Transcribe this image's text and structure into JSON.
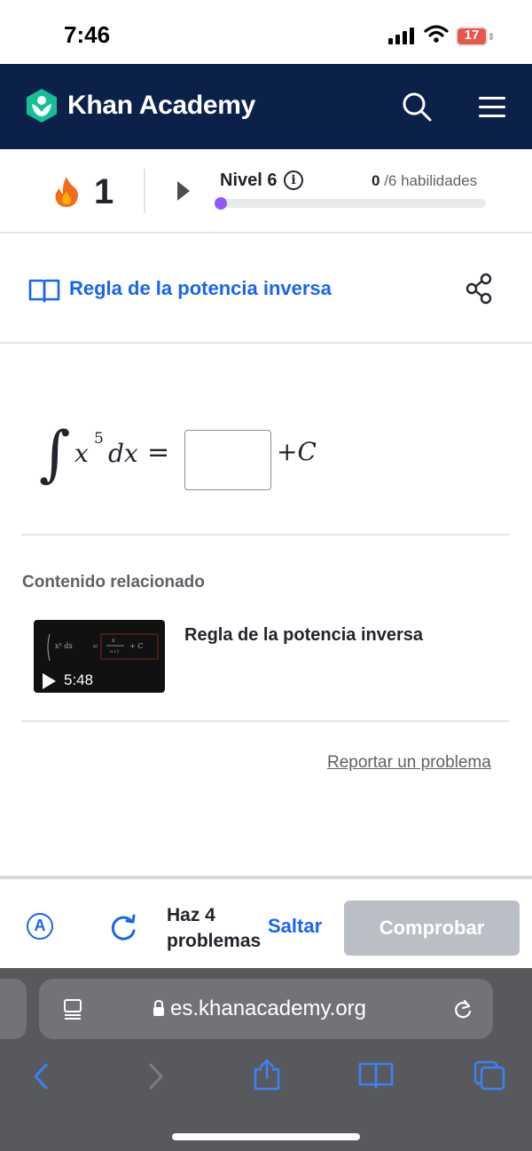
{
  "status_bar": {
    "time": "7:46",
    "battery": "17",
    "icons": [
      "cellular-signal-icon",
      "wifi-icon",
      "battery-icon"
    ]
  },
  "header": {
    "brand": "Khan Academy",
    "icons": [
      "khan-academy-logo-icon",
      "search-icon",
      "hamburger-menu-icon"
    ]
  },
  "progress": {
    "streak_count": "1",
    "level_label": "Nivel 6",
    "skills_done": "0",
    "skills_total": "/6 habilidades",
    "level_progress_fraction": 0.0
  },
  "topic": {
    "title": "Regla de la potencia inversa"
  },
  "exercise": {
    "integral": "∫",
    "variable": "x",
    "exponent": "5",
    "differential": "dx",
    "equals": "=",
    "constant_plus": "+",
    "constant": "C",
    "answer_value": ""
  },
  "related": {
    "heading": "Contenido relacionado",
    "video_title": "Regla de la potencia inversa",
    "video_duration": "5:48",
    "report_link": "Reportar un problema"
  },
  "actions": {
    "problems_line1": "Haz 4",
    "problems_line2": "problemas",
    "skip_label": "Saltar",
    "check_label": "Comprobar"
  },
  "browser": {
    "url": "es.khanacademy.org"
  },
  "colors": {
    "header_bg": "#0b2149",
    "link_blue": "#1865f2",
    "level_purple": "#9059ff",
    "streak_orange": "#f36b1c",
    "button_disabled": "#babec5"
  }
}
